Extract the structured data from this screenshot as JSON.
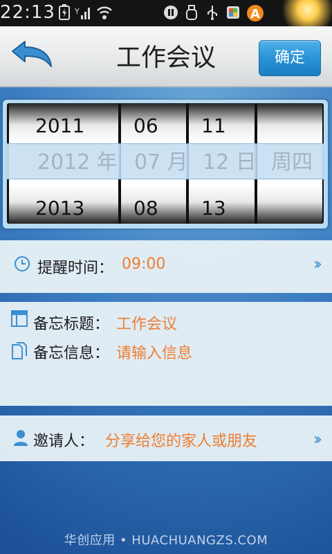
{
  "status": {
    "time": "22:13"
  },
  "header": {
    "title": "工作会议",
    "confirm_label": "确定"
  },
  "picker": {
    "year": {
      "prev": "2011",
      "selected": "2012 年",
      "next": "2013"
    },
    "month": {
      "prev": "06",
      "selected": "07 月",
      "next": "08"
    },
    "day": {
      "prev": "11",
      "selected": "12 日",
      "next": "13"
    },
    "weekday": {
      "selected": "周四"
    }
  },
  "reminder": {
    "label": "提醒时间：",
    "value": "09:00"
  },
  "memo": {
    "title_label": "备忘标题：",
    "title_value": "工作会议",
    "info_label": "备忘信息：",
    "info_placeholder": "请输入信息"
  },
  "invite": {
    "label": "邀请人：",
    "value": "分享给您的家人或朋友"
  },
  "footer": {
    "text": "华创应用 • HUACHUANGZS.COM"
  },
  "colors": {
    "accent": "#2790d3",
    "value_text": "#ef7d2f",
    "panel_bg": "#e6f0f6"
  },
  "icons": [
    "back-arrow-icon",
    "clock-icon",
    "calendar-icon",
    "document-icon",
    "person-icon",
    "double-chevron-right-icon"
  ]
}
